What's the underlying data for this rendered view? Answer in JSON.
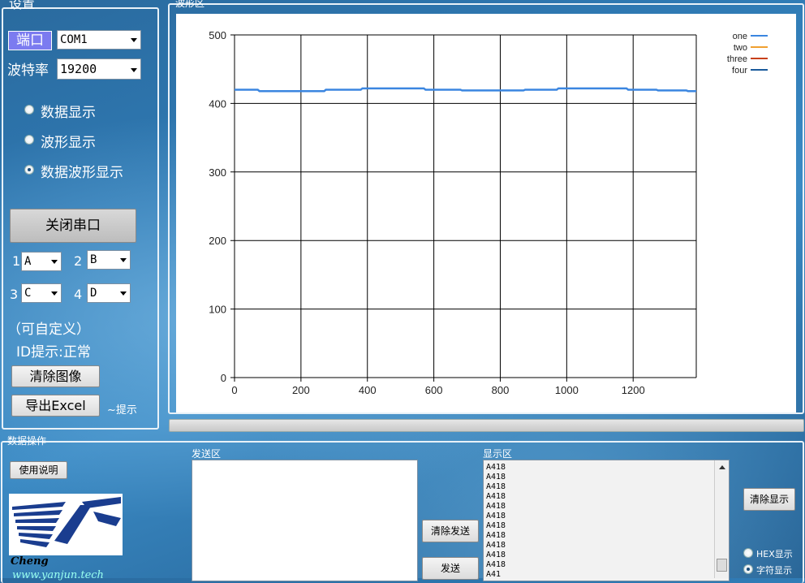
{
  "settings": {
    "title": "设置",
    "port_label": "端口",
    "port_value": "COM1",
    "baud_label": "波特率",
    "baud_value": "19200",
    "modes": [
      {
        "label": "数据显示",
        "checked": false
      },
      {
        "label": "波形显示",
        "checked": false
      },
      {
        "label": "数据波形显示",
        "checked": true
      }
    ],
    "close_port_button": "关闭串口",
    "channels": [
      {
        "num": "1",
        "value": "A"
      },
      {
        "num": "2",
        "value": "B"
      },
      {
        "num": "3",
        "value": "C"
      },
      {
        "num": "4",
        "value": "D"
      }
    ],
    "customizable_note": "（可自定义）",
    "id_hint": "ID提示:正常",
    "clear_image_button": "清除图像",
    "export_excel_button": "导出Excel",
    "hint_text": "~提示"
  },
  "waveform": {
    "title": "波形区"
  },
  "chart_data": {
    "type": "line",
    "xlim": [
      0,
      1390
    ],
    "ylim": [
      0,
      500
    ],
    "xticks": [
      "0",
      "200",
      "400",
      "600",
      "800",
      "1000",
      "1200"
    ],
    "yticks": [
      "0",
      "100",
      "200",
      "300",
      "400",
      "500"
    ],
    "grid": true,
    "legend_position": "top-right",
    "series": [
      {
        "name": "one",
        "color": "#3b86e0",
        "x": [
          0,
          70,
          75,
          270,
          275,
          380,
          385,
          570,
          575,
          680,
          685,
          870,
          875,
          970,
          975,
          1180,
          1185,
          1270,
          1275,
          1360,
          1365,
          1390
        ],
        "y": [
          420,
          420,
          418,
          418,
          420,
          420,
          422,
          422,
          420,
          420,
          419,
          419,
          420,
          420,
          422,
          422,
          420,
          420,
          419,
          419,
          418,
          418
        ]
      },
      {
        "name": "two",
        "color": "#f0a030",
        "x": [],
        "y": []
      },
      {
        "name": "three",
        "color": "#c8401a",
        "x": [],
        "y": []
      },
      {
        "name": "four",
        "color": "#1a5a9c",
        "x": [],
        "y": []
      }
    ]
  },
  "data_ops": {
    "title": "数据操作",
    "usage_button": "使用说明",
    "logo_caption": "Cheng",
    "website": "www.yanjun.tech",
    "send_area_label": "发送区",
    "send_text": "",
    "clear_send_button": "清除发送",
    "send_button": "发送",
    "display_area_label": "显示区",
    "display_lines": [
      "A418",
      "A418",
      "A418",
      "A418",
      "A418",
      "A418",
      "A418",
      "A418",
      "A418",
      "A418",
      "A418",
      "A41"
    ],
    "clear_display_button": "清除显示",
    "hex_display": "HEX显示",
    "char_display": "字符显示"
  }
}
